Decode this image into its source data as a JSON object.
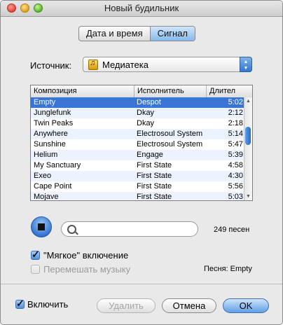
{
  "window": {
    "title": "Новый будильник"
  },
  "tabs": [
    {
      "label": "Дата и время",
      "active": false
    },
    {
      "label": "Сигнал",
      "active": true
    }
  ],
  "source": {
    "label": "Источник:",
    "value": "Медиатека",
    "icon": "music-library-icon"
  },
  "table": {
    "columns": [
      "Композиция",
      "Исполнитель",
      "Длител"
    ],
    "rows": [
      {
        "title": "Empty",
        "artist": "Despot",
        "duration": "5:02",
        "selected": true
      },
      {
        "title": "Junglefunk",
        "artist": "Dkay",
        "duration": "2:12"
      },
      {
        "title": "Twin Peaks",
        "artist": "Dkay",
        "duration": "2:18"
      },
      {
        "title": "Anywhere",
        "artist": "Electrosoul System",
        "duration": "5:14"
      },
      {
        "title": "Sunshine",
        "artist": "Electrosoul System",
        "duration": "5:47"
      },
      {
        "title": "Helium",
        "artist": "Engage",
        "duration": "5:39"
      },
      {
        "title": "My Sanctuary",
        "artist": "First State",
        "duration": "4:58"
      },
      {
        "title": "Exeo",
        "artist": "First State",
        "duration": "4:30"
      },
      {
        "title": "Cape Point",
        "artist": "First State",
        "duration": "5:56"
      },
      {
        "title": "Mojave",
        "artist": "First State",
        "duration": "5:03"
      }
    ]
  },
  "search": {
    "placeholder": "",
    "value": ""
  },
  "count_text": "249 песен",
  "options": {
    "fade_in": {
      "label": "\"Мягкое\" включение",
      "checked": true
    },
    "shuffle": {
      "label": "Перемешать музыку",
      "checked": false,
      "disabled": true
    }
  },
  "song_text": "Песня: Empty",
  "footer": {
    "enable": {
      "label": "Включить",
      "checked": true
    },
    "delete_label": "Удалить",
    "cancel_label": "Отмена",
    "ok_label": "OK"
  },
  "colors": {
    "selection": "#3875d7",
    "accent": "#2f77cf"
  }
}
